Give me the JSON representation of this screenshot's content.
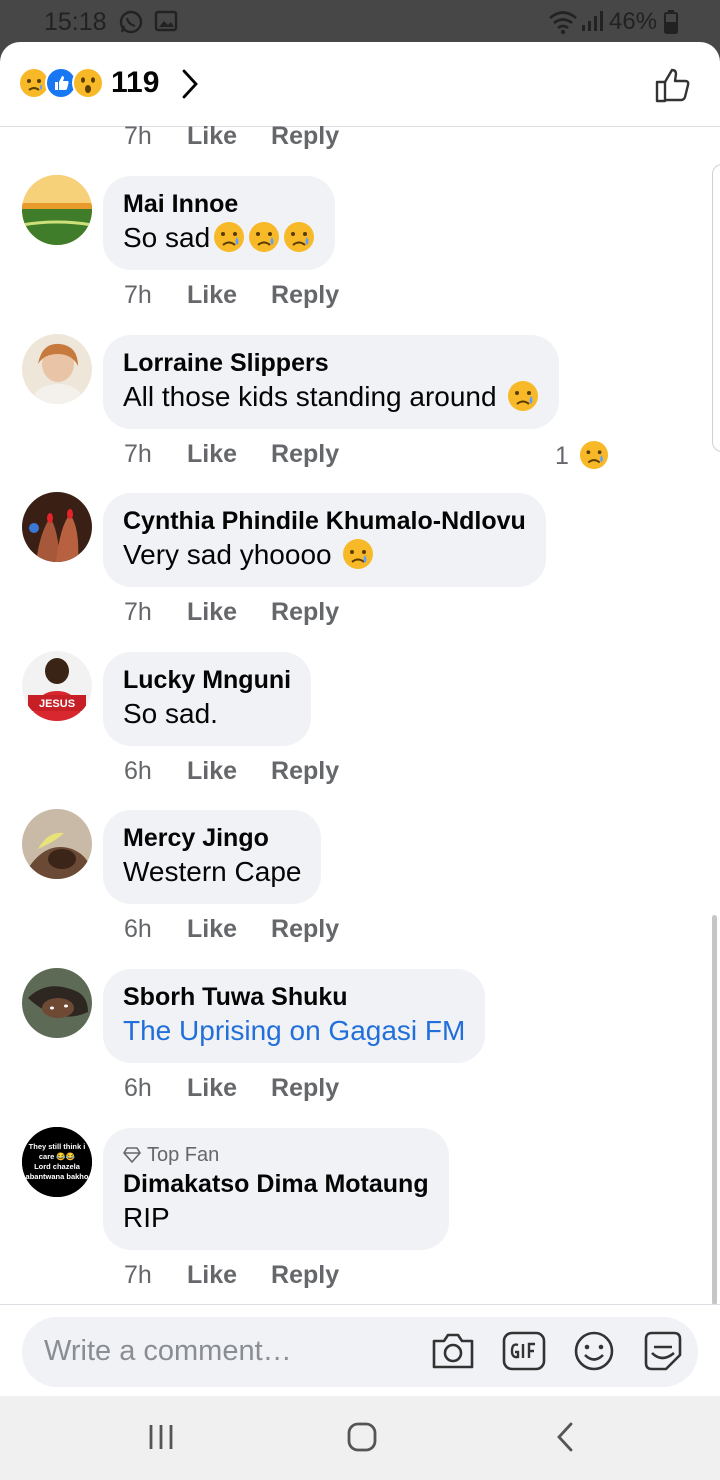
{
  "status_bar": {
    "time": "15:18",
    "battery": "46%"
  },
  "header": {
    "reaction_count": "119",
    "reactions": [
      "sad",
      "like",
      "wow"
    ]
  },
  "partial_actions": {
    "time": "7h",
    "like": "Like",
    "reply": "Reply"
  },
  "comments": [
    {
      "author": "Mai Innoe",
      "text": "So sad",
      "emoji_count": 3,
      "time": "7h",
      "like": "Like",
      "reply": "Reply"
    },
    {
      "author": "Lorraine Slippers",
      "text": "All those kids standing around",
      "emoji_count": 1,
      "time": "7h",
      "like": "Like",
      "reply": "Reply",
      "reaction_count": "1"
    },
    {
      "author": "Cynthia Phindile Khumalo-Ndlovu",
      "text": "Very sad yhoooo",
      "emoji_count": 1,
      "time": "7h",
      "like": "Like",
      "reply": "Reply"
    },
    {
      "author": "Lucky Mnguni",
      "text": "So sad.",
      "time": "6h",
      "like": "Like",
      "reply": "Reply"
    },
    {
      "author": "Mercy Jingo",
      "text": "Western Cape",
      "time": "6h",
      "like": "Like",
      "reply": "Reply"
    },
    {
      "author": "Sborh Tuwa Shuku",
      "text": "The Uprising on Gagasi FM",
      "is_link": true,
      "time": "6h",
      "like": "Like",
      "reply": "Reply"
    },
    {
      "badge": "Top Fan",
      "author": "Dimakatso Dima Motaung",
      "text": "RIP",
      "time": "7h",
      "like": "Like",
      "reply": "Reply"
    }
  ],
  "avatar_texts": {
    "lucky": "JESUS",
    "dimakatso": [
      "They still think i",
      "care 😂😂",
      "Lord chazela",
      "abantwana bakho"
    ]
  },
  "composer": {
    "placeholder": "Write a comment…"
  },
  "colors": {
    "link": "#216fdb",
    "bubble": "#f0f2f5",
    "secondary_text": "#65676b",
    "like_blue": "#1877f2",
    "emoji_yellow": "#f7b928"
  },
  "icons": [
    "whatsapp-icon",
    "gallery-icon",
    "wifi-icon",
    "signal-icon",
    "battery-icon",
    "chevron-right-icon",
    "thumbs-up-outline-icon",
    "camera-icon",
    "gif-icon",
    "smiley-icon",
    "sticker-icon",
    "recents-icon",
    "home-icon",
    "back-icon"
  ]
}
